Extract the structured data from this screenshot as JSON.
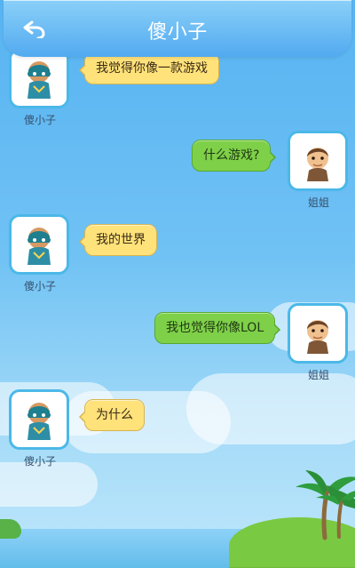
{
  "header": {
    "title": "傻小子",
    "back_icon": "back-arrow-icon"
  },
  "messages": [
    {
      "side": "left",
      "sender": "傻小子",
      "text": "我觉得你像一款游戏",
      "avatar_icon": "boy-hero-avatar-icon"
    },
    {
      "side": "right",
      "sender": "姐姐",
      "text": "什么游戏?",
      "avatar_icon": "sister-avatar-icon"
    },
    {
      "side": "left",
      "sender": "傻小子",
      "text": "我的世界",
      "avatar_icon": "boy-hero-avatar-icon"
    },
    {
      "side": "right",
      "sender": "姐姐",
      "text": "我也觉得你像LOL",
      "avatar_icon": "sister-avatar-icon"
    },
    {
      "side": "left",
      "sender": "傻小子",
      "text": "为什么",
      "avatar_icon": "boy-hero-avatar-icon"
    }
  ],
  "colors": {
    "left_bubble": "#ffe27a",
    "right_bubble": "#7ed048",
    "header": "#52aaf0"
  }
}
